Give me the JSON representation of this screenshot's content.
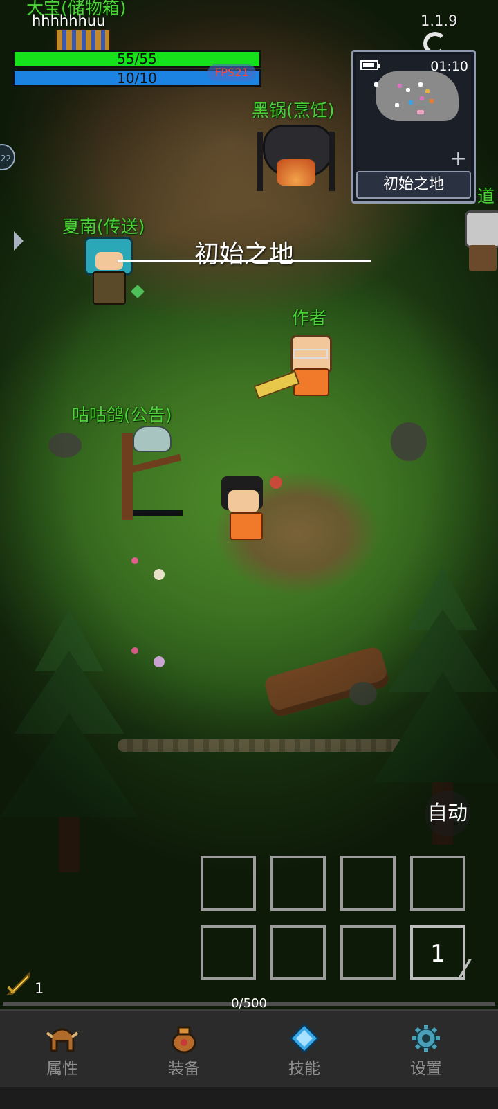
{
  "player": {
    "name": "hhhhhhuu",
    "hp": "55/55",
    "mp": "10/10",
    "fps": "FPS21"
  },
  "top_right": {
    "version": "1.1.9",
    "time": "01:10",
    "region_name": "初始之地",
    "plus": "+"
  },
  "area_title": "初始之地",
  "npcs": {
    "storage": "大宝(储物箱)",
    "cooking": "黑锅(烹饪)",
    "teleport": "夏南(传送)",
    "author": "作者",
    "notice": "咕咕鸽(公告)",
    "edge": "道"
  },
  "side": {
    "circle_text": "22"
  },
  "auto_button": "自动",
  "skill_slots": [
    "",
    "",
    "",
    "",
    "",
    "",
    "",
    "1"
  ],
  "resources": {
    "sword_count": "1",
    "exp": "0/500"
  },
  "nav": [
    {
      "label": "属性",
      "icon": "helmet-icon"
    },
    {
      "label": "装备",
      "icon": "bag-icon"
    },
    {
      "label": "技能",
      "icon": "crystal-icon"
    },
    {
      "label": "设置",
      "icon": "gear-icon"
    }
  ],
  "colors": {
    "hp": "#16e11a",
    "mp": "#1d83e3",
    "npc_label": "#4cd138",
    "fps_text": "#f24a3a"
  }
}
